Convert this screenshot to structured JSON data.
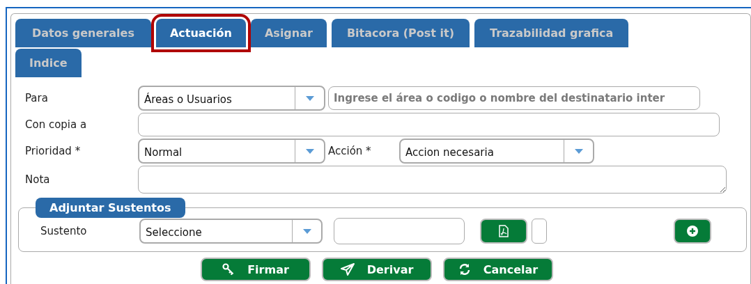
{
  "tabs": [
    {
      "label": "Datos generales",
      "selected": false,
      "highlighted": false
    },
    {
      "label": "Actuación",
      "selected": true,
      "highlighted": true
    },
    {
      "label": "Asignar",
      "selected": false,
      "highlighted": false
    },
    {
      "label": "Bitacora (Post it)",
      "selected": false,
      "highlighted": false
    },
    {
      "label": "Trazabilidad grafica",
      "selected": false,
      "highlighted": false
    },
    {
      "label": "Indice",
      "selected": false,
      "highlighted": false
    }
  ],
  "form": {
    "para": {
      "label": "Para",
      "select_value": "Áreas o Usuarios",
      "placeholder": "Ingrese el área o codigo o nombre del destinatario inter"
    },
    "con_copia": {
      "label": "Con copia a"
    },
    "prioridad": {
      "label": "Prioridad *",
      "value": "Normal"
    },
    "accion": {
      "label": "Acción *",
      "value": "Accion necesaria"
    },
    "nota": {
      "label": "Nota"
    }
  },
  "attachments": {
    "legend": "Adjuntar Sustentos",
    "label": "Sustento",
    "select_value": "Seleccione"
  },
  "buttons": [
    {
      "label": "Firmar",
      "kind": "sign"
    },
    {
      "label": "Derivar",
      "kind": "send"
    },
    {
      "label": "Cancelar",
      "kind": "cancel"
    }
  ]
}
